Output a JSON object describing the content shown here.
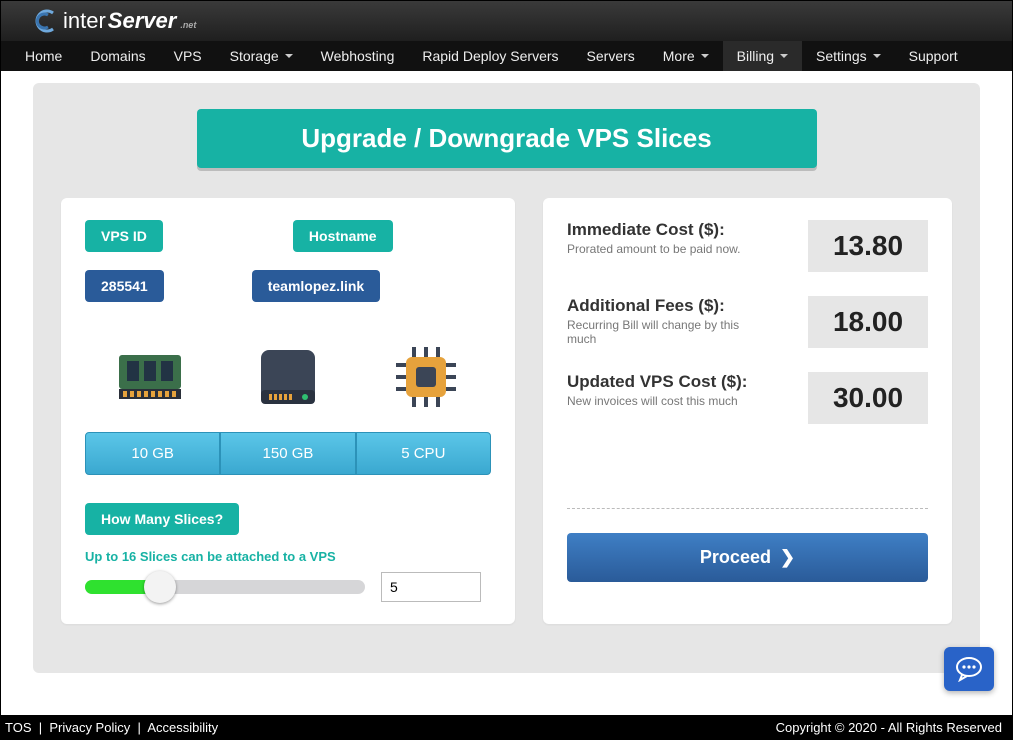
{
  "brand": {
    "part1": "inter",
    "part2": "Server",
    "suffix": ".net"
  },
  "nav": {
    "items": [
      {
        "label": "Home",
        "caret": false
      },
      {
        "label": "Domains",
        "caret": false
      },
      {
        "label": "VPS",
        "caret": false
      },
      {
        "label": "Storage",
        "caret": true
      },
      {
        "label": "Webhosting",
        "caret": false
      },
      {
        "label": "Rapid Deploy Servers",
        "caret": false
      },
      {
        "label": "Servers",
        "caret": false
      },
      {
        "label": "More",
        "caret": true
      },
      {
        "label": "Billing",
        "caret": true,
        "active": true
      },
      {
        "label": "Settings",
        "caret": true
      },
      {
        "label": "Support",
        "caret": false
      }
    ]
  },
  "page_title": "Upgrade / Downgrade VPS Slices",
  "left": {
    "vps_id_label": "VPS ID",
    "hostname_label": "Hostname",
    "vps_id_value": "285541",
    "hostname_value": "teamlopez.link",
    "specs": {
      "ram": "10 GB",
      "disk": "150 GB",
      "cpu": "5 CPU"
    },
    "slices_label": "How Many Slices?",
    "slices_note": "Up to 16 Slices can be attached to a VPS",
    "slices_value": "5"
  },
  "right": {
    "rows": [
      {
        "title": "Immediate Cost ($):",
        "sub": "Prorated amount to be paid now.",
        "value": "13.80"
      },
      {
        "title": "Additional Fees ($):",
        "sub": "Recurring Bill will change by this much",
        "value": "18.00"
      },
      {
        "title": "Updated VPS Cost ($):",
        "sub": "New invoices will cost this much",
        "value": "30.00"
      }
    ],
    "proceed_label": "Proceed"
  },
  "footer": {
    "tos": "TOS",
    "privacy": "Privacy Policy",
    "accessibility": "Accessibility",
    "copyright": "Copyright © 2020 - All Rights Reserved"
  }
}
